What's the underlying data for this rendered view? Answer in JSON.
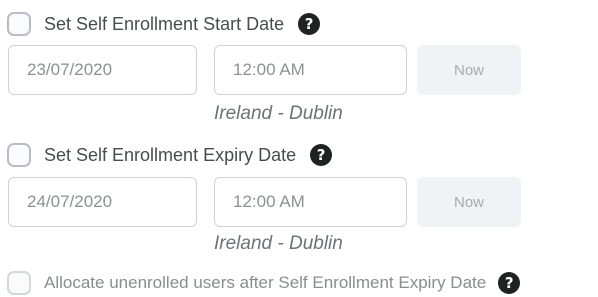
{
  "start": {
    "checkbox_label": "Set Self Enrollment Start Date",
    "help_glyph": "?",
    "date_value": "23/07/2020",
    "time_value": "12:00 AM",
    "now_label": "Now",
    "timezone": "Ireland - Dublin"
  },
  "expiry": {
    "checkbox_label": "Set Self Enrollment Expiry Date",
    "help_glyph": "?",
    "date_value": "24/07/2020",
    "time_value": "12:00 AM",
    "now_label": "Now",
    "timezone": "Ireland - Dublin"
  },
  "allocate": {
    "checkbox_label": "Allocate unenrolled users after Self Enrollment Expiry Date",
    "help_glyph": "?"
  },
  "icons": {
    "help": "question-circle-icon"
  }
}
